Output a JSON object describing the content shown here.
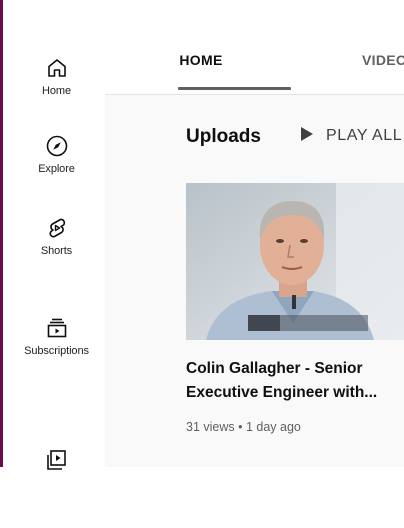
{
  "sidebar": {
    "items": [
      {
        "label": "Home",
        "icon": "home-icon"
      },
      {
        "label": "Explore",
        "icon": "compass-icon"
      },
      {
        "label": "Shorts",
        "icon": "shorts-icon"
      },
      {
        "label": "Subscriptions",
        "icon": "subscriptions-icon"
      },
      {
        "label": "",
        "icon": "library-icon"
      }
    ]
  },
  "tabs": [
    {
      "label": "HOME",
      "selected": true
    },
    {
      "label": "VIDEOS",
      "selected": false
    }
  ],
  "section": {
    "title": "Uploads",
    "play_all_label": "PLAY ALL"
  },
  "video": {
    "title_line1": "Colin Gallagher - Senior",
    "title_line2": "Executive Engineer with...",
    "meta": "31 views • 1 day ago"
  },
  "colors": {
    "accent_bar": "#606060",
    "text_primary": "#0f0f0f",
    "text_secondary": "#606060",
    "frame": "#6a0c4a"
  }
}
